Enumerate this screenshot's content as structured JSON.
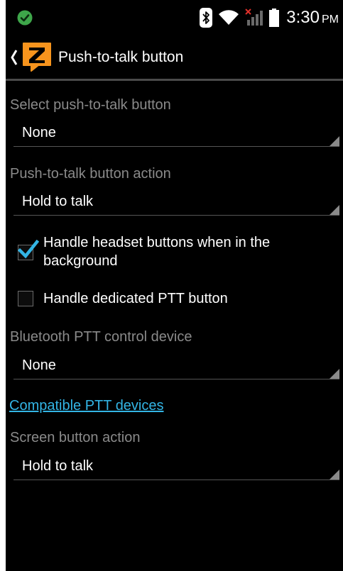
{
  "status_bar": {
    "time": "3:30",
    "ampm": "PM",
    "icons": [
      "check-circle-icon",
      "bluetooth-icon",
      "wifi-icon",
      "cellular-no-signal-icon",
      "battery-icon"
    ],
    "accent_green": "#3ea64a"
  },
  "action_bar": {
    "title": "Push-to-talk button",
    "logo_letter": "Z",
    "logo_color": "#f7941d"
  },
  "settings": {
    "select_button": {
      "label": "Select push-to-talk button",
      "value": "None"
    },
    "button_action": {
      "label": "Push-to-talk button action",
      "value": "Hold to talk"
    },
    "headset_buttons": {
      "label": "Handle headset buttons when in the background",
      "checked": true
    },
    "dedicated_ptt": {
      "label": "Handle dedicated PTT button",
      "checked": false
    },
    "bluetooth_device": {
      "label": "Bluetooth PTT control device",
      "value": "None"
    },
    "compatible_link": "Compatible PTT devices",
    "screen_button_action": {
      "label": "Screen button action",
      "value": "Hold to talk"
    }
  },
  "colors": {
    "background": "#000000",
    "secondary_text": "#8a8a8a",
    "link": "#33b5e5",
    "checkmark": "#33b5e5"
  }
}
